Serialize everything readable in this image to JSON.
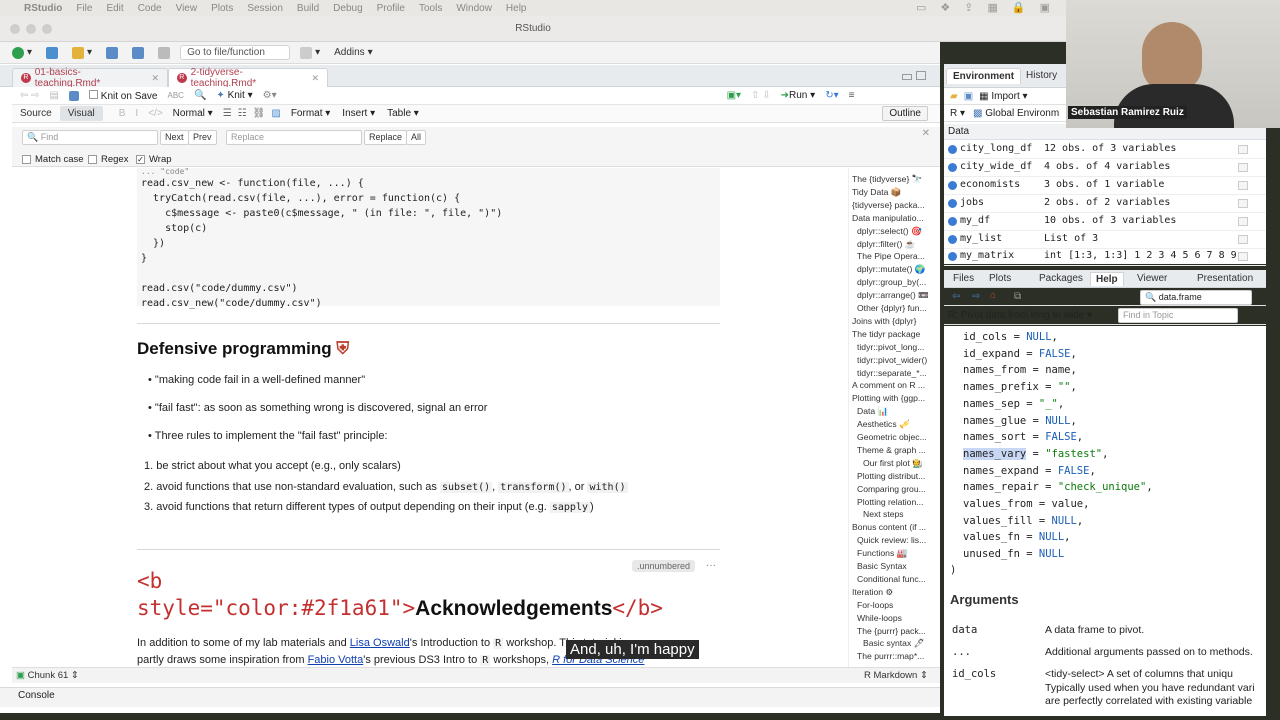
{
  "menubar": {
    "app": "RStudio",
    "items": [
      "File",
      "Edit",
      "Code",
      "View",
      "Plots",
      "Session",
      "Build",
      "Debug",
      "Profile",
      "Tools",
      "Window",
      "Help"
    ]
  },
  "window": {
    "title": "RStudio"
  },
  "maintoolbar": {
    "goto_placeholder": "Go to file/function",
    "addins": "Addins"
  },
  "tabs": [
    {
      "label": "01-basics-teaching.Rmd*"
    },
    {
      "label": "2-tidyverse-teaching.Rmd*"
    }
  ],
  "editor_toolbar": {
    "knit_on_save": "Knit on Save",
    "knit": "Knit",
    "run": "Run"
  },
  "mode": {
    "source": "Source",
    "visual": "Visual",
    "normal": "Normal",
    "format": "Format",
    "insert": "Insert",
    "table": "Table",
    "outline": "Outline"
  },
  "find": {
    "find_placeholder": "Find",
    "next": "Next",
    "prev": "Prev",
    "replace_placeholder": "Replace",
    "replace": "Replace",
    "all": "All",
    "match_case": "Match case",
    "regex": "Regex",
    "wrap": "Wrap"
  },
  "code": {
    "lines": [
      "  ...  \"code\"  ",
      "read.csv_new <- function(file, ...) {",
      "  tryCatch(read.csv(file, ...), error = function(c) {",
      "    c$message <- paste0(c$message, \" (in file: \", file, \")\")",
      "    stop(c)",
      "  })",
      "}",
      "",
      "read.csv(\"code/dummy.csv\")",
      "read.csv_new(\"code/dummy.csv\")"
    ]
  },
  "doc": {
    "heading": "Defensive programming",
    "bullets": [
      "\"making code fail in a well-defined manner\"",
      "\"fail fast\": as soon as something wrong is discovered, signal an error",
      "Three rules to implement the \"fail fast\" principle:"
    ],
    "rule1": "be strict about what you accept (e.g., only scalars)",
    "rule2_pre": "avoid functions that use non-standard evaluation, such as",
    "rule2_c1": "subset()",
    "rule2_c2": "transform()",
    "rule2_or": ", or",
    "rule2_c3": "with()",
    "rule3_pre": "avoid functions that return different types of output depending on their input (e.g.",
    "rule3_c": "sapply",
    "unnumbered": ".unnumbered",
    "raw_line1": "<b",
    "raw_line2": "style=\"color:#2f1a61\">",
    "raw_text": "Acknowledgements",
    "raw_end": "</b>",
    "para1_pre": "In addition to some of my lab materials and",
    "para1_link": "Lisa Oswald",
    "para1_post": "'s Introduction to",
    "para1_r": "R",
    "para1_post2": "workshop. This tutorial is",
    "para2_pre": "partly draws some inspiration from",
    "para2_link": "Fabio Votta",
    "para2_post": "'s previous DS3 Intro to",
    "para2_r": "R",
    "para2_post2": "workshops,",
    "para2_link2": "R for Data Science",
    "caption": "And, uh, I'm happy"
  },
  "outline": [
    "The {tidyverse} 🔭",
    "Tidy Data 📦",
    "{tidyverse} packa...",
    "Data manipulatio...",
    "dplyr::select() 🎯",
    "dplyr::filter() ☕",
    "The Pipe Opera...",
    "dplyr::mutate() 🌍",
    "dplyr::group_by(...",
    "dplyr::arrange() 📼",
    "Other {dplyr} fun...",
    "Joins with {dplyr}",
    "The tidyr package",
    "tidyr::pivot_long...",
    "tidyr::pivot_wider()",
    "tidyr::separate_*...",
    "A comment on R ...",
    "Plotting with {ggp...",
    "Data 📊",
    "Aesthetics 🎺",
    "Geometric objec...",
    "Theme & graph ...",
    "Our first plot 🧑‍🌾",
    "Plotting distribut...",
    "Comparing grou...",
    "Plotting relation...",
    "Next steps",
    "Bonus content (if ...",
    "Quick review: lis...",
    "Functions 🏭",
    "Basic Syntax",
    "Conditional func...",
    "Iteration ⚙",
    "For-loops",
    "While-loops",
    "The {purrr} pack...",
    "Basic syntax 🖊",
    "The purrr::map*..."
  ],
  "status": {
    "chunk": "Chunk 61",
    "mode": "R Markdown"
  },
  "console": {
    "label": "Console"
  },
  "env": {
    "tabs": [
      "Environment",
      "History"
    ],
    "import": "Import",
    "r": "R",
    "global": "Global Environm",
    "section": "Data",
    "rows": [
      {
        "name": "city_long_df",
        "value": "12 obs. of 3 variables"
      },
      {
        "name": "city_wide_df",
        "value": "4 obs. of 4 variables"
      },
      {
        "name": "economists",
        "value": "3 obs. of 1 variable"
      },
      {
        "name": "jobs",
        "value": "2 obs. of 2 variables"
      },
      {
        "name": "my_df",
        "value": "10 obs. of 3 variables"
      },
      {
        "name": "my_list",
        "value": "List of  3"
      },
      {
        "name": "my_matrix",
        "value": "int [1:3, 1:3] 1 2 3 4 5 6 7 8 9"
      }
    ]
  },
  "speaker": "Sebastian Ramirez Ruiz",
  "help": {
    "tabs": [
      "Files",
      "Plots",
      "Packages",
      "Help",
      "Viewer",
      "Presentation"
    ],
    "search": "data.frame",
    "topic": "R: Pivot data from long to wide",
    "find_topic": "Find in Topic",
    "args_heading": "Arguments",
    "code": [
      {
        "k": "id_cols",
        "op": " = ",
        "v": "NULL",
        "t": "b"
      },
      {
        "k": "id_expand",
        "op": " = ",
        "v": "FALSE",
        "t": "b"
      },
      {
        "k": "names_from",
        "op": " = ",
        "v": "name",
        "t": ""
      },
      {
        "k": "names_prefix",
        "op": " = ",
        "v": "\"\"",
        "t": "s"
      },
      {
        "k": "names_sep",
        "op": " = ",
        "v": "\"_\"",
        "t": "s"
      },
      {
        "k": "names_glue",
        "op": " = ",
        "v": "NULL",
        "t": "b"
      },
      {
        "k": "names_sort",
        "op": " = ",
        "v": "FALSE",
        "t": "b"
      },
      {
        "k": "names_vary",
        "op": " = ",
        "v": "\"fastest\"",
        "t": "s"
      },
      {
        "k": "names_expand",
        "op": " = ",
        "v": "FALSE",
        "t": "b"
      },
      {
        "k": "names_repair",
        "op": " = ",
        "v": "\"check_unique\"",
        "t": "s"
      },
      {
        "k": "values_from",
        "op": " = ",
        "v": "value",
        "t": ""
      },
      {
        "k": "values_fill",
        "op": " = ",
        "v": "NULL",
        "t": "b"
      },
      {
        "k": "values_fn",
        "op": " = ",
        "v": "NULL",
        "t": "b"
      },
      {
        "k": "unused_fn",
        "op": " = ",
        "v": "NULL",
        "t": "b"
      }
    ],
    "args": [
      {
        "name": "data",
        "desc": "A data frame to pivot."
      },
      {
        "name": "...",
        "desc": "Additional arguments passed on to methods."
      },
      {
        "name": "id_cols",
        "desc": "<tidy-select> A set of columns that uniqu"
      }
    ],
    "id_cols_more1": "Typically used when you have redundant vari",
    "id_cols_more2": "are perfectly correlated with existing variable"
  }
}
